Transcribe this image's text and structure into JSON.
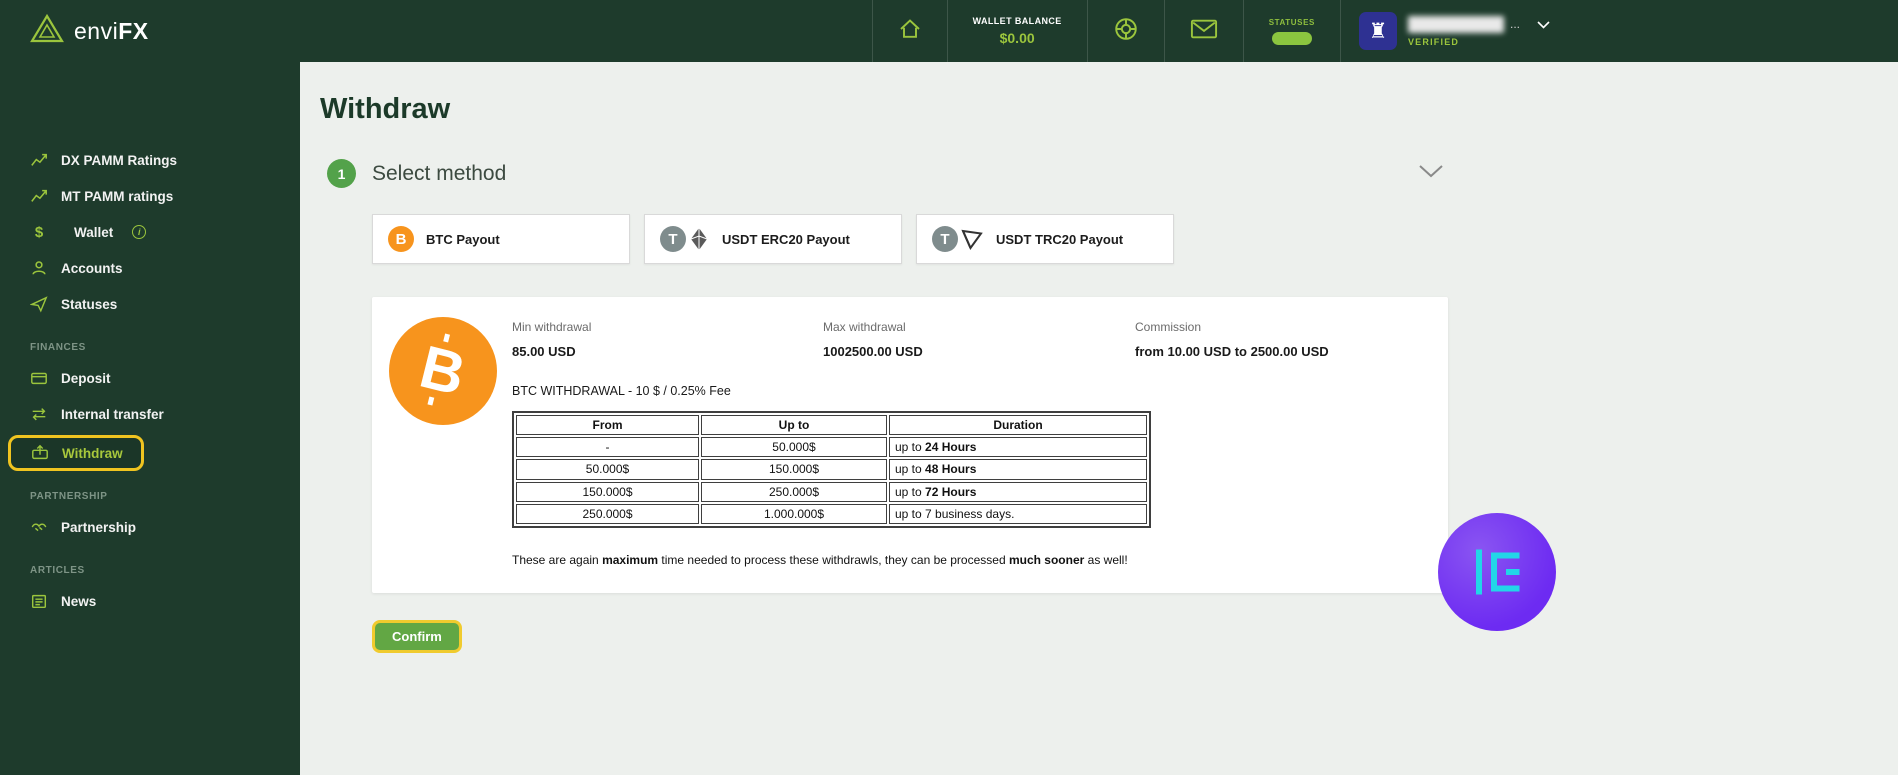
{
  "theme": {
    "header_bg": "#1e3b2c",
    "accent_green": "#9bc53d",
    "highlight_yellow": "#f0c420",
    "content_bg": "#edf0ed",
    "btc_orange": "#f7941d",
    "watermark_purple": "#6d2bf2",
    "watermark_cyan": "#22d6e8"
  },
  "header": {
    "brand": {
      "name_regular": "envi",
      "name_bold": "FX"
    },
    "wallet": {
      "label": "WALLET BALANCE",
      "value": "$0.00"
    },
    "statuses_label": "STATUSES",
    "user": {
      "name_suffix": "...",
      "verified": "VERIFIED",
      "avatar_glyph": "♜"
    }
  },
  "sidebar": {
    "groups": [
      {
        "title": "",
        "items": [
          {
            "label": "DX PAMM Ratings"
          },
          {
            "label": "MT PAMM ratings"
          },
          {
            "label": "Wallet"
          },
          {
            "label": "Accounts"
          },
          {
            "label": "Statuses"
          }
        ]
      },
      {
        "title": "FINANCES",
        "items": [
          {
            "label": "Deposit"
          },
          {
            "label": "Internal transfer"
          },
          {
            "label": "Withdraw"
          }
        ]
      },
      {
        "title": "PARTNERSHIP",
        "items": [
          {
            "label": "Partnership"
          }
        ]
      },
      {
        "title": "ARTICLES",
        "items": [
          {
            "label": "News"
          }
        ]
      }
    ],
    "wallet_info_glyph": "i"
  },
  "main": {
    "page_title": "Withdraw",
    "step_number": "1",
    "step_title": "Select method",
    "methods": [
      {
        "label": "BTC Payout",
        "coin_glyph": "B"
      },
      {
        "label": "USDT ERC20 Payout",
        "coin_glyph": "T"
      },
      {
        "label": "USDT TRC20 Payout",
        "coin_glyph": "T"
      }
    ],
    "details": {
      "min_label": "Min withdrawal",
      "min_value": "85.00 USD",
      "max_label": "Max withdrawal",
      "max_value": "1002500.00 USD",
      "commission_label": "Commission",
      "commission_value": "from 10.00 USD to 2500.00 USD",
      "fee_line": "BTC WITHDRAWAL - 10 $ / 0.25% Fee",
      "table": {
        "headers": [
          "From",
          "Up to",
          "Duration"
        ],
        "rows": [
          {
            "from": "-",
            "upto": "50.000$",
            "dur_pre": "up to ",
            "dur_bold": "24 Hours"
          },
          {
            "from": "50.000$",
            "upto": "150.000$",
            "dur_pre": "up to ",
            "dur_bold": "48 Hours"
          },
          {
            "from": "150.000$",
            "upto": "250.000$",
            "dur_pre": "up to ",
            "dur_bold": "72 Hours"
          },
          {
            "from": "250.000$",
            "upto": "1.000.000$",
            "dur_pre": "up to 7 business days.",
            "dur_bold": ""
          }
        ]
      },
      "note": {
        "p1": "These are again ",
        "b1": "maximum",
        "p2": " time needed to process these withdrawls, they can be processed ",
        "b2": "much sooner",
        "p3": " as well!"
      }
    },
    "confirm_label": "Confirm"
  }
}
